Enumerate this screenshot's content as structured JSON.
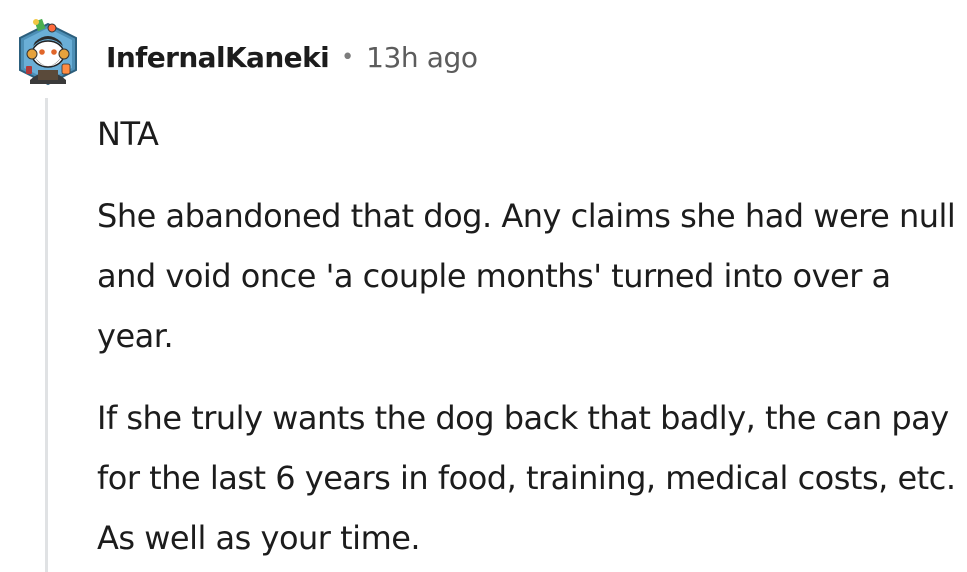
{
  "comment": {
    "author": "InfernalKaneki",
    "separator": "•",
    "timestamp": "13h ago",
    "paragraphs": [
      "NTA",
      "She abandoned that dog. Any claims she had were null and void once 'a couple months' turned into over a year.",
      "If she truly wants the dog back that badly, the can pay for the last 6 years in food, training, medical costs, etc. As well as your time."
    ]
  },
  "avatar": {
    "icon": "snoo-avatar-icon",
    "hex_border_color": "#4a90a4",
    "bg_color": "#4d8fb6"
  },
  "thread_line_color": "#e0e2e4"
}
